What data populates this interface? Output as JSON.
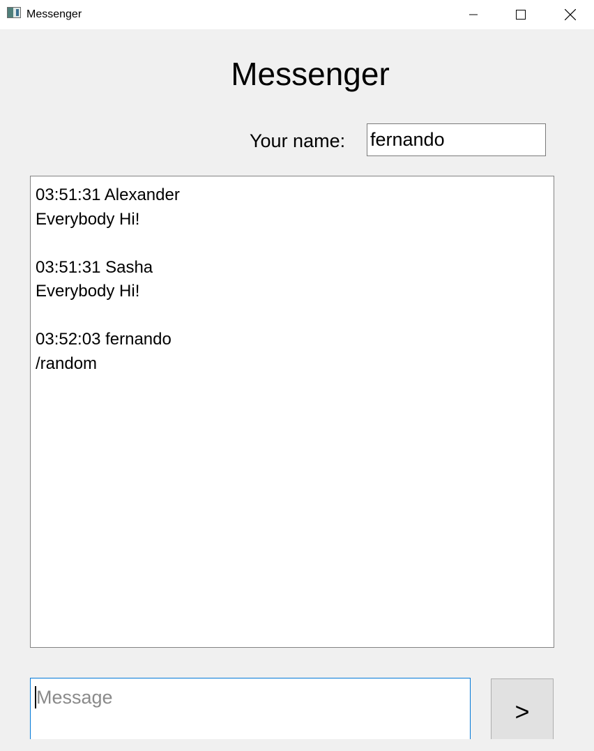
{
  "window": {
    "title": "Messenger"
  },
  "header": {
    "title": "Messenger",
    "name_label": "Your name:",
    "name_value": "fernando"
  },
  "chat": {
    "messages": [
      {
        "time_author": "03:51:31 Alexander",
        "text": "Everybody Hi!"
      },
      {
        "time_author": "03:51:31 Sasha",
        "text": "Everybody Hi!"
      },
      {
        "time_author": "03:52:03 fernando",
        "text": "/random"
      }
    ]
  },
  "composer": {
    "placeholder": "Message",
    "value": "",
    "send_label": ">"
  },
  "icons": {
    "app": "app-window-icon",
    "minimize": "minimize-icon",
    "maximize": "maximize-icon",
    "close": "close-icon"
  },
  "colors": {
    "window_bg": "#f0f0f0",
    "focus_border": "#0078d7",
    "button_bg": "#e1e1e1"
  }
}
